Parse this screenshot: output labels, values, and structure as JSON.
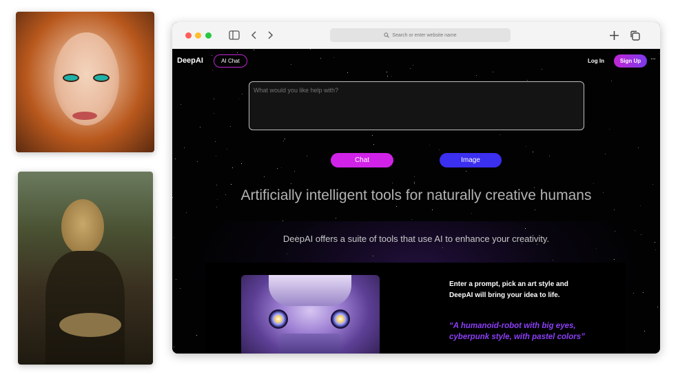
{
  "browser": {
    "address_placeholder": "Search or enter website name"
  },
  "header": {
    "logo": "DeepAI",
    "ai_chat_label": "AI Chat",
    "login_label": "Log In",
    "signup_label": "Sign Up",
    "more_label": "···"
  },
  "prompt": {
    "placeholder": "What would you like help with?"
  },
  "actions": {
    "chat_label": "Chat",
    "image_label": "Image"
  },
  "hero": {
    "headline": "Artificially intelligent tools for naturally creative humans",
    "subline": "DeepAI offers a suite of tools that use AI to enhance your creativity."
  },
  "feature": {
    "description": "Enter a prompt, pick an art style and DeepAI will bring your idea to life.",
    "quote": "“A humanoid-robot with big eyes, cyberpunk style, with pastel colors”"
  },
  "colors": {
    "accent_magenta": "#d123e8",
    "accent_blue": "#3b2ff0",
    "quote_purple": "#8b3ff7"
  },
  "icons": [
    "sidebar-icon",
    "back-icon",
    "forward-icon",
    "search-icon",
    "new-tab-icon",
    "tabs-icon",
    "more-icon"
  ]
}
